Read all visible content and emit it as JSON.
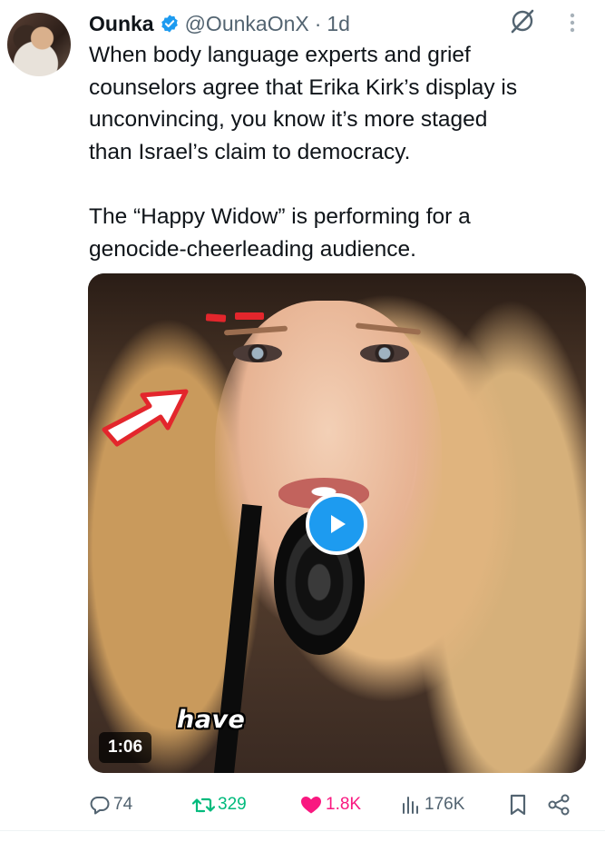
{
  "author": {
    "name": "Ounka",
    "handle": "@OunkaOnX",
    "separator": "·",
    "time": "1d",
    "verified_color": "#1d9bf0"
  },
  "icons": {
    "verified": "verified-badge-icon",
    "grok": "grok-icon",
    "more": "more-options-icon",
    "reply": "reply-icon",
    "retweet": "retweet-icon",
    "like": "heart-icon",
    "views": "views-icon",
    "bookmark": "bookmark-icon",
    "share": "share-icon",
    "play": "play-icon"
  },
  "tweet": {
    "paragraph1_line1": "When body language experts and grief",
    "paragraph1_line2": "counselors agree that Erika Kirk’s display is",
    "paragraph1_line3": "unconvincing, you know it’s more staged",
    "paragraph1_line4": "than Israel’s claim to democracy.",
    "paragraph2_line1": "The “Happy Widow” is performing for a",
    "paragraph2_line2": "genocide-cheerleading audience."
  },
  "media": {
    "caption": "have",
    "duration": "1:06"
  },
  "actions": {
    "replies": "74",
    "retweets": "329",
    "likes": "1.8K",
    "views": "176K"
  },
  "colors": {
    "text": "#0f1419",
    "secondary": "#536471",
    "retweet_active": "#00ba7c",
    "like_active": "#f91880",
    "accent": "#1d9bf0"
  }
}
